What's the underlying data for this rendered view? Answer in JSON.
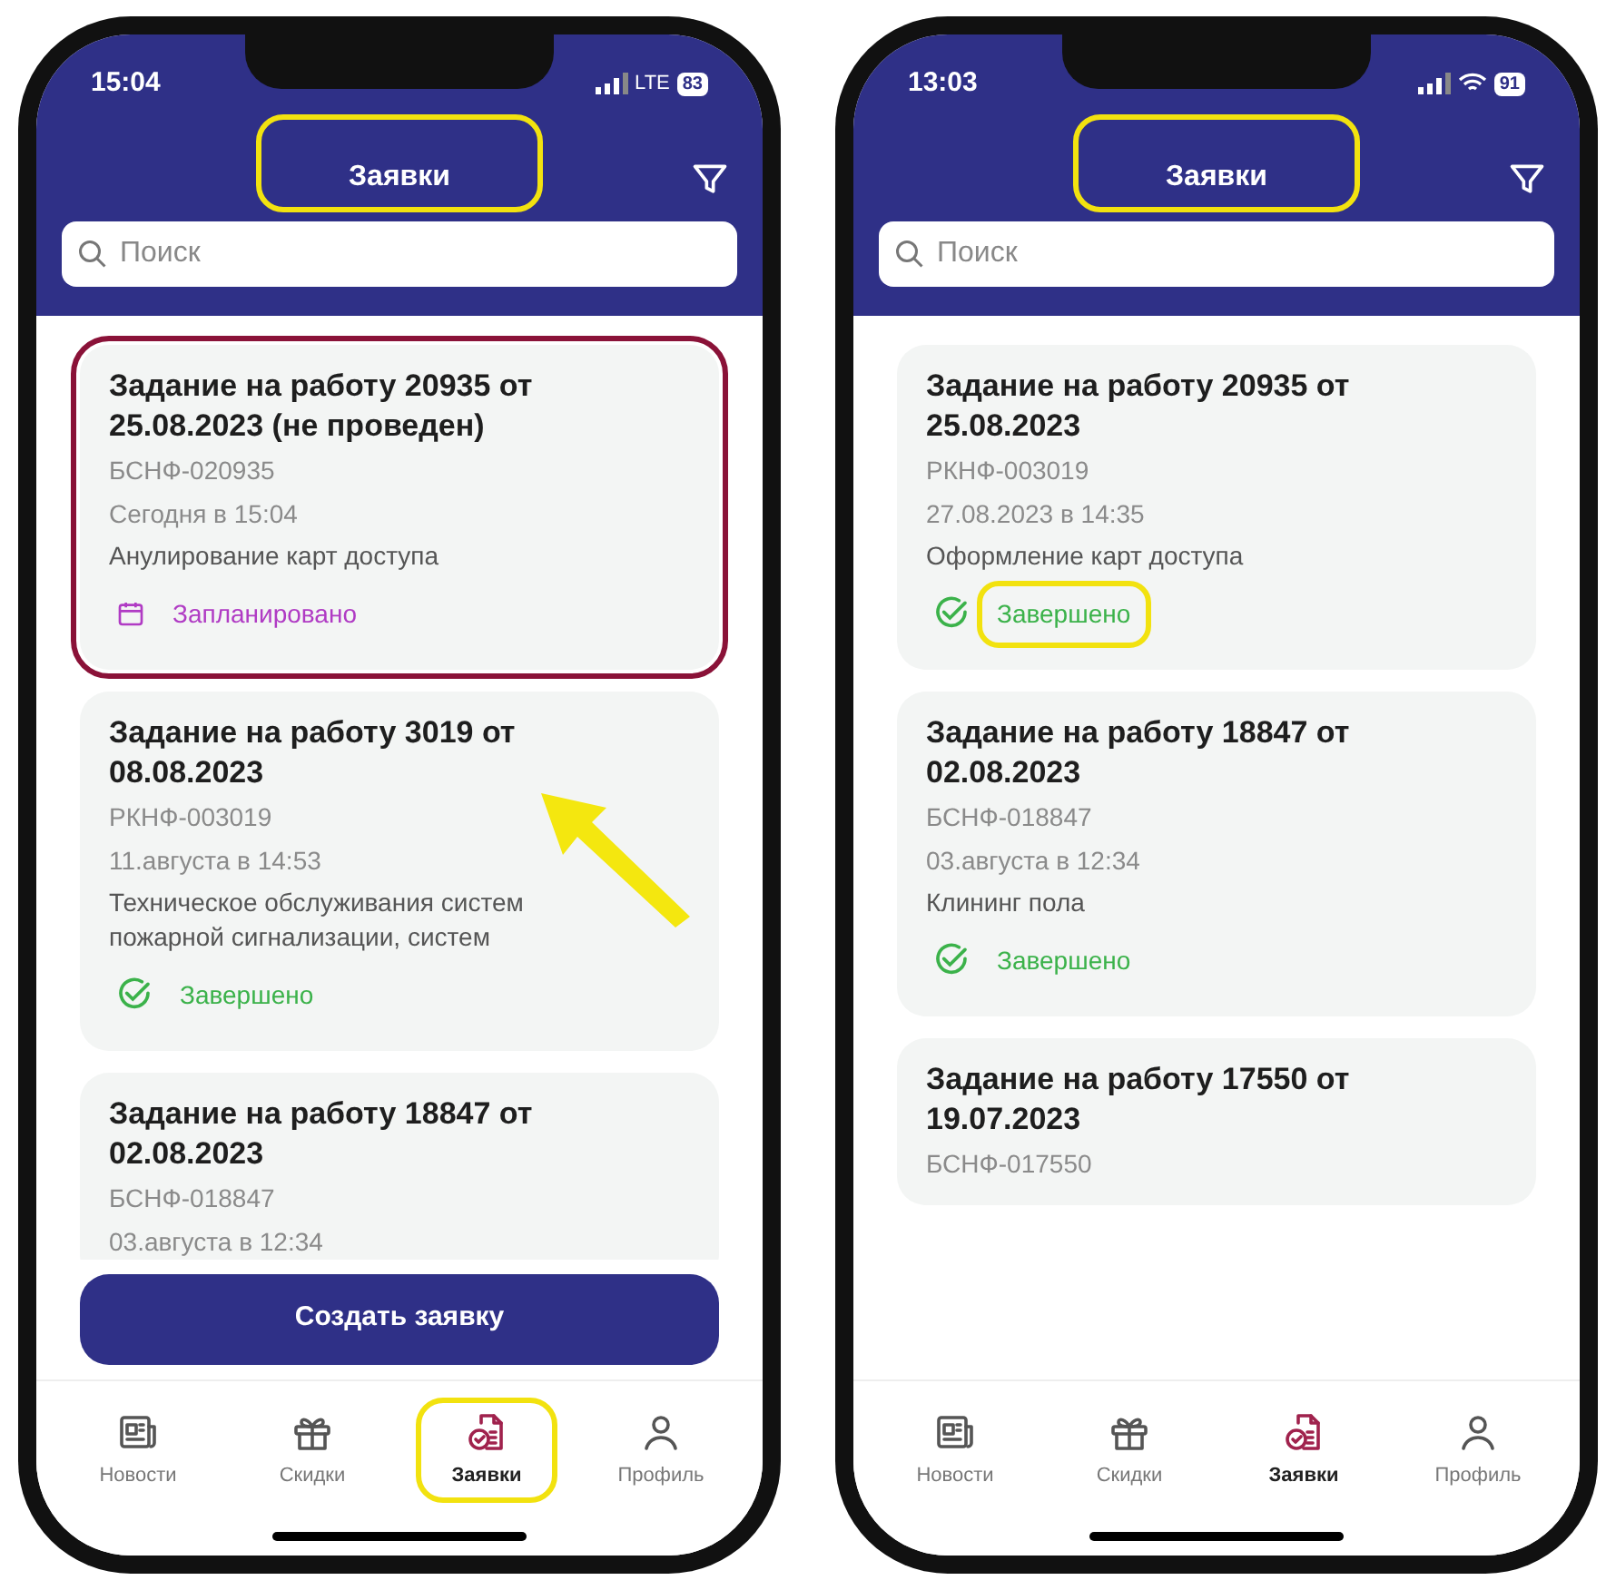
{
  "phones": [
    {
      "status_bar": {
        "time": "15:04",
        "connection": {
          "kind": "cellular_text",
          "label": "LTE"
        },
        "battery": "83"
      },
      "header": {
        "title": "Заявки",
        "highlighted": true
      },
      "search": {
        "placeholder": "Поиск"
      },
      "pointer_arrow": true,
      "cards": [
        {
          "title": "Задание на работу 20935 от 25.08.2023 (не проведен)",
          "code": "БСНФ-020935",
          "date": "Сегодня в 15:04",
          "description": "Анулирование карт доступа",
          "status": {
            "kind": "planned",
            "label": "Запланировано",
            "highlighted": false
          },
          "highlighted": true
        },
        {
          "title": "Задание на работу 3019 от 08.08.2023",
          "code": "РКНФ-003019",
          "date": "11.августа в 14:53",
          "description": "Техническое обслуживания систем пожарной сигнализации, систем",
          "status": {
            "kind": "done",
            "label": "Завершено",
            "highlighted": false
          },
          "highlighted": false
        },
        {
          "title": "Задание на работу 18847 от 02.08.2023",
          "code": "БСНФ-018847",
          "date": "03.августа в 12:34",
          "highlighted": false
        }
      ],
      "create_button": "Создать заявку",
      "nav": [
        {
          "kind": "news",
          "label": "Новости",
          "selected": false,
          "highlighted": false
        },
        {
          "kind": "gift",
          "label": "Скидки",
          "selected": false,
          "highlighted": false
        },
        {
          "kind": "requests",
          "label": "Заявки",
          "selected": true,
          "highlighted": true
        },
        {
          "kind": "profile",
          "label": "Профиль",
          "selected": false,
          "highlighted": false
        }
      ]
    },
    {
      "status_bar": {
        "time": "13:03",
        "connection": {
          "kind": "wifi"
        },
        "battery": "91"
      },
      "header": {
        "title": "Заявки",
        "highlighted": true
      },
      "search": {
        "placeholder": "Поиск"
      },
      "pointer_arrow": false,
      "cards": [
        {
          "title": "Задание на работу 20935 от 25.08.2023",
          "code": "РКНФ-003019",
          "date": "27.08.2023 в 14:35",
          "description": "Оформление карт доступа",
          "status": {
            "kind": "done",
            "label": "Завершено",
            "highlighted": true
          },
          "highlighted": false
        },
        {
          "title": "Задание на работу 18847 от 02.08.2023",
          "code": "БСНФ-018847",
          "date": "03.августа в 12:34",
          "description": "Клининг пола",
          "status": {
            "kind": "done",
            "label": "Завершено",
            "highlighted": false
          },
          "highlighted": false
        },
        {
          "title": "Задание на работу 17550 от 19.07.2023",
          "code": "БСНФ-017550",
          "highlighted": false
        }
      ],
      "nav": [
        {
          "kind": "news",
          "label": "Новости",
          "selected": false,
          "highlighted": false
        },
        {
          "kind": "gift",
          "label": "Скидки",
          "selected": false,
          "highlighted": false
        },
        {
          "kind": "requests",
          "label": "Заявки",
          "selected": true,
          "highlighted": false
        },
        {
          "kind": "profile",
          "label": "Профиль",
          "selected": false,
          "highlighted": false
        }
      ]
    }
  ]
}
